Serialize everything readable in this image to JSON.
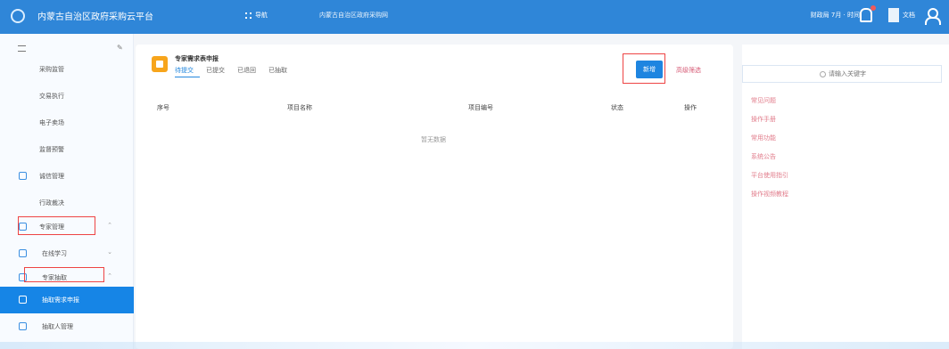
{
  "app": {
    "title": "内蒙古自治区政府采购云平台",
    "apps_label": "导航",
    "region_label": "内蒙古自治区政府采购网",
    "user_label": "财政局 7月 · 时间",
    "doc_label": "文档"
  },
  "sidebar": {
    "items": [
      {
        "label": "采购监管"
      },
      {
        "label": "交易执行"
      },
      {
        "label": "电子卖场"
      },
      {
        "label": "监督预警"
      },
      {
        "label": "诚信管理"
      },
      {
        "label": "行政裁决"
      },
      {
        "label": "专家管理"
      },
      {
        "label": "在线学习"
      },
      {
        "label": "专家抽取"
      },
      {
        "label": "抽取需求申报"
      },
      {
        "label": "抽取人管理"
      }
    ]
  },
  "main": {
    "page_title": "专家需求表申报",
    "tabs": [
      "待提交",
      "已提交",
      "已退回",
      "已抽取"
    ],
    "new_button": "新增",
    "more": "高级筛选",
    "columns": [
      "序号",
      "项目名称",
      "项目编号",
      "状态",
      "操作"
    ],
    "empty_text": "暂无数据"
  },
  "right": {
    "search_placeholder": "请输入关键字",
    "items": [
      "常见问题",
      "操作手册",
      "常用功能",
      "系统公告",
      "平台使用指引",
      "操作视频教程"
    ]
  },
  "colors": {
    "topbar": "#2f86d8",
    "active": "#1685e6",
    "annotation_red": "#e44",
    "accent_orange": "#f7a51c"
  }
}
